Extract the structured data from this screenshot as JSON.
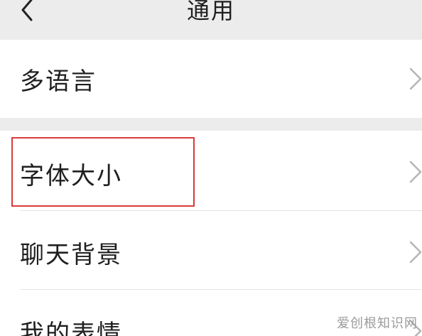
{
  "header": {
    "title": "通用",
    "back_icon": "chevron-left-icon"
  },
  "settings_items": [
    {
      "label": "多语言",
      "icon": "chevron-right-icon"
    },
    {
      "label": "字体大小",
      "icon": "chevron-right-icon",
      "highlighted": true
    },
    {
      "label": "聊天背景",
      "icon": "chevron-right-icon"
    },
    {
      "label": "我的表情",
      "icon": "chevron-right-icon"
    }
  ],
  "highlight_color": "#d93b3b",
  "watermark": "爱创根知识网"
}
